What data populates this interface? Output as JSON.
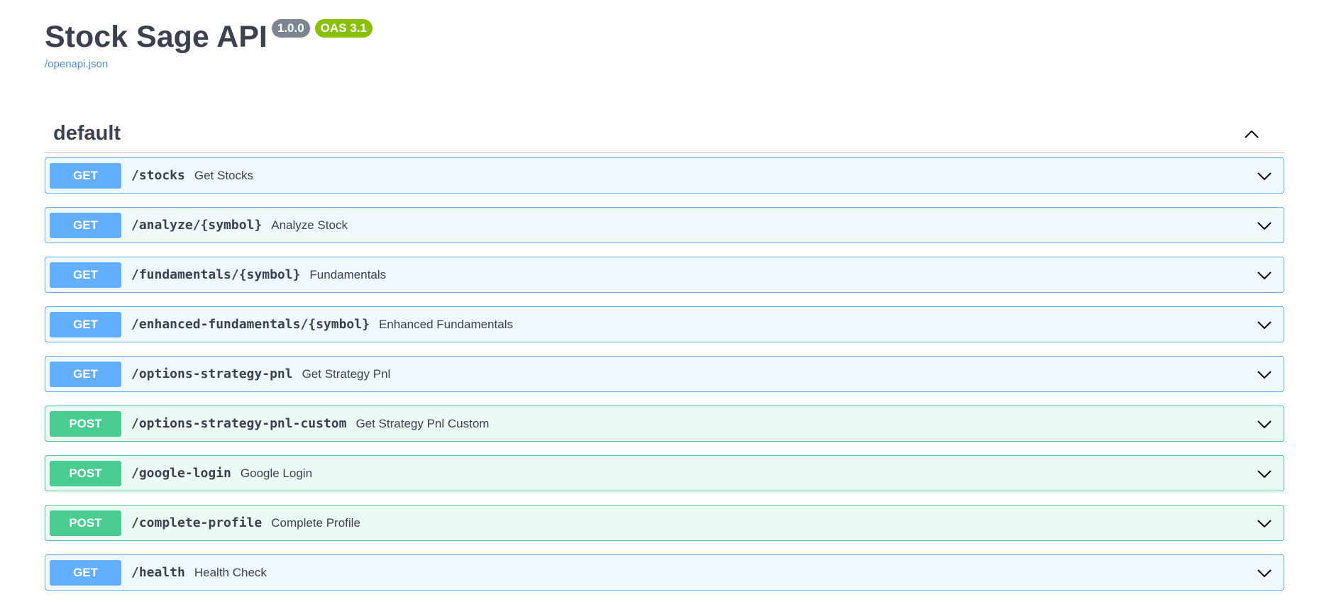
{
  "info": {
    "title": "Stock Sage API",
    "version": "1.0.0",
    "oas": "OAS 3.1",
    "spec_link": "/openapi.json"
  },
  "tag": {
    "name": "default",
    "toggle_icon": "chevron-up-icon"
  },
  "colors": {
    "get": "#61affe",
    "post": "#49cc90",
    "version_badge": "#7d8492",
    "oas_badge": "#89bf04",
    "link": "#4990e2"
  },
  "operations": [
    {
      "method": "GET",
      "path": "/stocks",
      "summary": "Get Stocks"
    },
    {
      "method": "GET",
      "path": "/analyze/{symbol}",
      "summary": "Analyze Stock"
    },
    {
      "method": "GET",
      "path": "/fundamentals/{symbol}",
      "summary": "Fundamentals"
    },
    {
      "method": "GET",
      "path": "/enhanced-fundamentals/{symbol}",
      "summary": "Enhanced Fundamentals"
    },
    {
      "method": "GET",
      "path": "/options-strategy-pnl",
      "summary": "Get Strategy Pnl"
    },
    {
      "method": "POST",
      "path": "/options-strategy-pnl-custom",
      "summary": "Get Strategy Pnl Custom"
    },
    {
      "method": "POST",
      "path": "/google-login",
      "summary": "Google Login"
    },
    {
      "method": "POST",
      "path": "/complete-profile",
      "summary": "Complete Profile"
    },
    {
      "method": "GET",
      "path": "/health",
      "summary": "Health Check"
    }
  ]
}
